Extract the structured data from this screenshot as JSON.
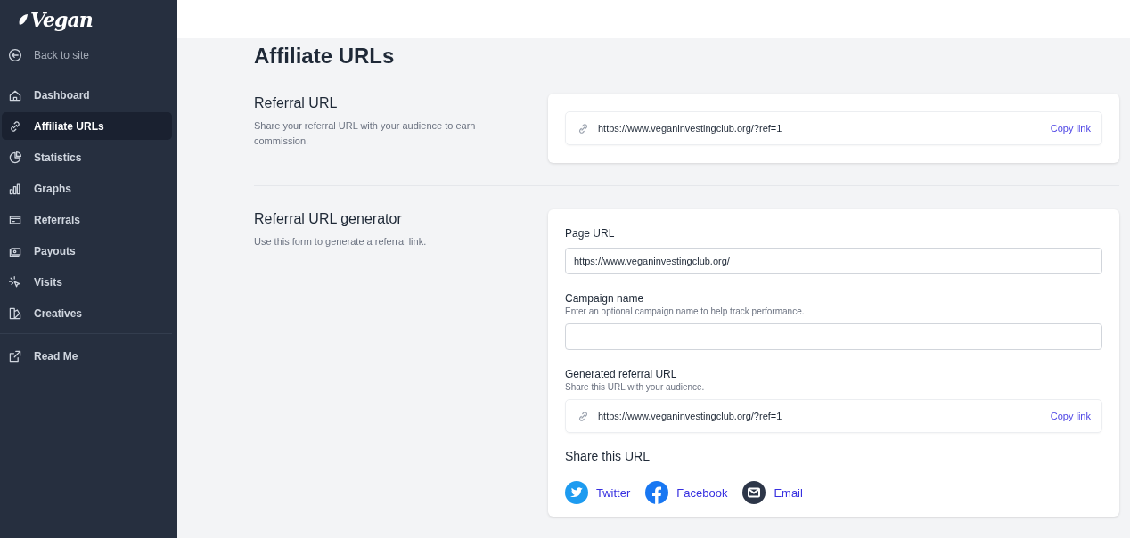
{
  "sidebar": {
    "logo": "Vegan",
    "back_link": "Back to site",
    "items": [
      {
        "label": "Dashboard",
        "kind": "home",
        "selected": false
      },
      {
        "label": "Affiliate URLs",
        "kind": "link",
        "selected": true
      },
      {
        "label": "Statistics",
        "kind": "pie",
        "selected": false
      },
      {
        "label": "Graphs",
        "kind": "bars",
        "selected": false
      },
      {
        "label": "Referrals",
        "kind": "card",
        "selected": false
      },
      {
        "label": "Payouts",
        "kind": "cash",
        "selected": false
      },
      {
        "label": "Visits",
        "kind": "cursor",
        "selected": false
      },
      {
        "label": "Creatives",
        "kind": "swatch",
        "selected": false
      }
    ],
    "footer_item": {
      "label": "Read Me",
      "kind": "external"
    }
  },
  "page_title": "Affiliate URLs",
  "referral": {
    "title": "Referral URL",
    "description": "Share your referral URL with your audience to earn commission.",
    "url": "https://www.veganinvestingclub.org/?ref=1",
    "copy": "Copy link"
  },
  "generator": {
    "title": "Referral URL generator",
    "description": "Use this form to generate a referral link.",
    "page_url": {
      "label": "Page URL",
      "value": "https://www.veganinvestingclub.org/"
    },
    "campaign": {
      "label": "Campaign name",
      "hint": "Enter an optional campaign name to help track performance."
    },
    "generated": {
      "label": "Generated referral URL",
      "hint": "Share this URL with your audience.",
      "url": "https://www.veganinvestingclub.org/?ref=1",
      "copy": "Copy link"
    },
    "share_title": "Share this URL",
    "share": [
      {
        "label": "Twitter",
        "kind": "twitter",
        "color": "#1d9bf0"
      },
      {
        "label": "Facebook",
        "kind": "facebook",
        "color": "#1877f2"
      },
      {
        "label": "Email",
        "kind": "email",
        "color": "#2d3648"
      }
    ]
  }
}
